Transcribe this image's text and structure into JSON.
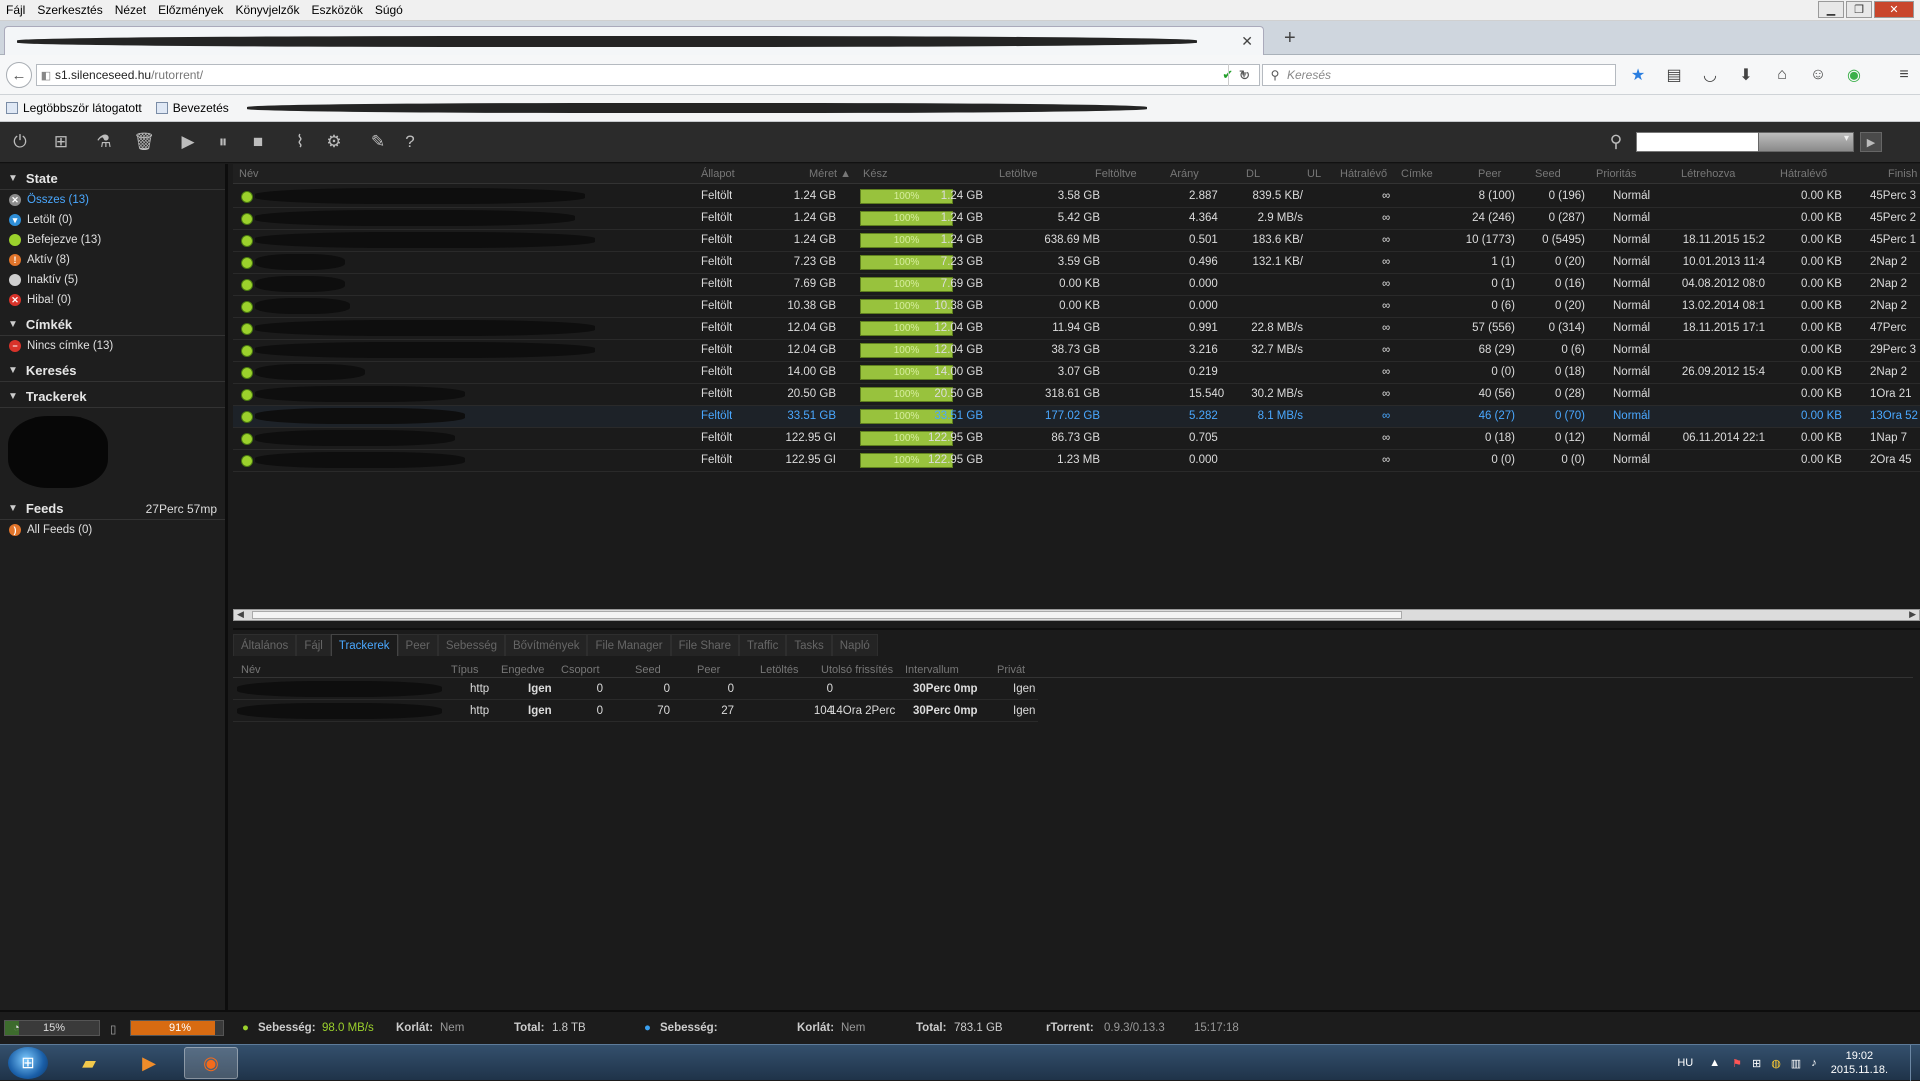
{
  "menu": [
    "Fájl",
    "Szerkesztés",
    "Nézet",
    "Előzmények",
    "Könyvjelzők",
    "Eszközök",
    "Súgó"
  ],
  "navbar": {
    "url_host": "s1.silenceseed.hu",
    "url_path": "/rutorrent/",
    "search_placeholder": "Keresés"
  },
  "bookmarks": [
    "Legtöbbször látogatott",
    "Bevezetés"
  ],
  "sidebar": {
    "state_title": "State",
    "state_items": [
      {
        "label": "Összes (13)",
        "color": "#8c8c8c",
        "glyph": "✕",
        "active": true
      },
      {
        "label": "Letölt (0)",
        "color": "#2f8fd8",
        "glyph": "▾",
        "active": false
      },
      {
        "label": "Befejezve (13)",
        "color": "#9bd12c",
        "glyph": "",
        "active": false
      },
      {
        "label": "Aktív (8)",
        "color": "#e0742a",
        "glyph": "!",
        "active": false
      },
      {
        "label": "Inaktív (5)",
        "color": "#cfcfcf",
        "glyph": "",
        "active": false
      },
      {
        "label": "Hiba! (0)",
        "color": "#d8332a",
        "glyph": "✕",
        "active": false
      }
    ],
    "labels_title": "Címkék",
    "labels_item": "Nincs címke (13)",
    "search_title": "Keresés",
    "trackers_title": "Trackerek",
    "feeds_title": "Feeds",
    "feeds_time": "27Perc 57mp",
    "feeds_item": "All Feeds (0)"
  },
  "table": {
    "headers": {
      "name": "Név",
      "status": "Állapot",
      "size": "Méret ▲",
      "done": "Kész",
      "downloaded": "Letöltve",
      "uploaded": "Feltöltve",
      "ratio": "Arány",
      "dl": "DL",
      "ul": "UL",
      "eta": "Hátralévő",
      "label": "Címke",
      "peers": "Peer",
      "seeds": "Seed",
      "priority": "Prioritás",
      "created": "Létrehozva",
      "remaining": "Hátralévő",
      "finished": "Finish"
    },
    "rows": [
      {
        "status": "Feltölt",
        "size": "1.24 GB",
        "done": "100%",
        "downloaded": "1.24 GB",
        "uploaded": "3.58 GB",
        "ratio": "2.887",
        "dl": "",
        "ul": "839.5 KB/",
        "eta": "∞",
        "peers": "8 (100)",
        "seeds": "0 (196)",
        "priority": "Normál",
        "created": "",
        "remaining": "0.00 KB",
        "finished": "45Perc 3",
        "sel": false
      },
      {
        "status": "Feltölt",
        "size": "1.24 GB",
        "done": "100%",
        "downloaded": "1.24 GB",
        "uploaded": "5.42 GB",
        "ratio": "4.364",
        "dl": "",
        "ul": "2.9 MB/s",
        "eta": "∞",
        "peers": "24 (246)",
        "seeds": "0 (287)",
        "priority": "Normál",
        "created": "",
        "remaining": "0.00 KB",
        "finished": "45Perc 2",
        "sel": false
      },
      {
        "status": "Feltölt",
        "size": "1.24 GB",
        "done": "100%",
        "downloaded": "1.24 GB",
        "uploaded": "638.69 MB",
        "ratio": "0.501",
        "dl": "",
        "ul": "183.6 KB/",
        "eta": "∞",
        "peers": "10 (1773)",
        "seeds": "0 (5495)",
        "priority": "Normál",
        "created": "18.11.2015 15:2",
        "remaining": "0.00 KB",
        "finished": "45Perc 1",
        "sel": false
      },
      {
        "status": "Feltölt",
        "size": "7.23 GB",
        "done": "100%",
        "downloaded": "7.23 GB",
        "uploaded": "3.59 GB",
        "ratio": "0.496",
        "dl": "",
        "ul": "132.1 KB/",
        "eta": "∞",
        "peers": "1 (1)",
        "seeds": "0 (20)",
        "priority": "Normál",
        "created": "10.01.2013 11:4",
        "remaining": "0.00 KB",
        "finished": "2Nap 2",
        "sel": false
      },
      {
        "status": "Feltölt",
        "size": "7.69 GB",
        "done": "100%",
        "downloaded": "7.69 GB",
        "uploaded": "0.00 KB",
        "ratio": "0.000",
        "dl": "",
        "ul": "",
        "eta": "∞",
        "peers": "0 (1)",
        "seeds": "0 (16)",
        "priority": "Normál",
        "created": "04.08.2012 08:0",
        "remaining": "0.00 KB",
        "finished": "2Nap 2",
        "sel": false
      },
      {
        "status": "Feltölt",
        "size": "10.38 GB",
        "done": "100%",
        "downloaded": "10.38 GB",
        "uploaded": "0.00 KB",
        "ratio": "0.000",
        "dl": "",
        "ul": "",
        "eta": "∞",
        "peers": "0 (6)",
        "seeds": "0 (20)",
        "priority": "Normál",
        "created": "13.02.2014 08:1",
        "remaining": "0.00 KB",
        "finished": "2Nap 2",
        "sel": false
      },
      {
        "status": "Feltölt",
        "size": "12.04 GB",
        "done": "100%",
        "downloaded": "12.04 GB",
        "uploaded": "11.94 GB",
        "ratio": "0.991",
        "dl": "",
        "ul": "22.8 MB/s",
        "eta": "∞",
        "peers": "57 (556)",
        "seeds": "0 (314)",
        "priority": "Normál",
        "created": "18.11.2015 17:1",
        "remaining": "0.00 KB",
        "finished": "47Perc",
        "sel": false
      },
      {
        "status": "Feltölt",
        "size": "12.04 GB",
        "done": "100%",
        "downloaded": "12.04 GB",
        "uploaded": "38.73 GB",
        "ratio": "3.216",
        "dl": "",
        "ul": "32.7 MB/s",
        "eta": "∞",
        "peers": "68 (29)",
        "seeds": "0 (6)",
        "priority": "Normál",
        "created": "",
        "remaining": "0.00 KB",
        "finished": "29Perc 3",
        "sel": false
      },
      {
        "status": "Feltölt",
        "size": "14.00 GB",
        "done": "100%",
        "downloaded": "14.00 GB",
        "uploaded": "3.07 GB",
        "ratio": "0.219",
        "dl": "",
        "ul": "",
        "eta": "∞",
        "peers": "0 (0)",
        "seeds": "0 (18)",
        "priority": "Normál",
        "created": "26.09.2012 15:4",
        "remaining": "0.00 KB",
        "finished": "2Nap 2",
        "sel": false
      },
      {
        "status": "Feltölt",
        "size": "20.50 GB",
        "done": "100%",
        "downloaded": "20.50 GB",
        "uploaded": "318.61 GB",
        "ratio": "15.540",
        "dl": "",
        "ul": "30.2 MB/s",
        "eta": "∞",
        "peers": "40 (56)",
        "seeds": "0 (28)",
        "priority": "Normál",
        "created": "",
        "remaining": "0.00 KB",
        "finished": "1Óra 21",
        "sel": false
      },
      {
        "status": "Feltölt",
        "size": "33.51 GB",
        "done": "100%",
        "downloaded": "33.51 GB",
        "uploaded": "177.02 GB",
        "ratio": "5.282",
        "dl": "",
        "ul": "8.1 MB/s",
        "eta": "∞",
        "peers": "46 (27)",
        "seeds": "0 (70)",
        "priority": "Normál",
        "created": "",
        "remaining": "0.00 KB",
        "finished": "13Óra 52",
        "sel": true
      },
      {
        "status": "Feltölt",
        "size": "122.95 GI",
        "done": "100%",
        "downloaded": "122.95 GB",
        "uploaded": "86.73 GB",
        "ratio": "0.705",
        "dl": "",
        "ul": "",
        "eta": "∞",
        "peers": "0 (18)",
        "seeds": "0 (12)",
        "priority": "Normál",
        "created": "06.11.2014 22:1",
        "remaining": "0.00 KB",
        "finished": "1Nap 7",
        "sel": false
      },
      {
        "status": "Feltölt",
        "size": "122.95 GI",
        "done": "100%",
        "downloaded": "122.95 GB",
        "uploaded": "1.23 MB",
        "ratio": "0.000",
        "dl": "",
        "ul": "",
        "eta": "∞",
        "peers": "0 (0)",
        "seeds": "0 (0)",
        "priority": "Normál",
        "created": "",
        "remaining": "0.00 KB",
        "finished": "2Óra 45",
        "sel": false
      }
    ]
  },
  "panel": {
    "tabs": [
      "Általános",
      "Fájl",
      "Trackerek",
      "Peer",
      "Sebesség",
      "Bővítmények",
      "File Manager",
      "File Share",
      "Traffic",
      "Tasks",
      "Napló"
    ],
    "active_tab": "Trackerek",
    "headers": {
      "name": "Név",
      "type": "Típus",
      "enabled": "Engedve",
      "group": "Csoport",
      "seed": "Seed",
      "peer": "Peer",
      "downloads": "Letöltés",
      "last": "Utolsó frissítés",
      "interval": "Intervallum",
      "private": "Privát"
    },
    "rows": [
      {
        "type": "http",
        "enabled": "Igen",
        "group": "0",
        "seed": "0",
        "peer": "0",
        "downloads": "0",
        "last": "",
        "interval": "30Perc 0mp",
        "private": "Igen"
      },
      {
        "type": "http",
        "enabled": "Igen",
        "group": "0",
        "seed": "70",
        "peer": "27",
        "downloads": "104",
        "last": "14Óra 2Perc",
        "interval": "30Perc 0mp",
        "private": "Igen"
      }
    ]
  },
  "status": {
    "cpu": "15%",
    "disk": "91%",
    "dl_speed_label": "Sebesség:",
    "dl_speed": "98.0 MB/s",
    "dl_limit_label": "Korlát:",
    "dl_limit": "Nem",
    "dl_total_label": "Total:",
    "dl_total": "1.8 TB",
    "ul_speed_label": "Sebesség:",
    "ul_limit_label": "Korlát:",
    "ul_limit": "Nem",
    "ul_total_label": "Total:",
    "ul_total": "783.1 GB",
    "rt_label": "rTorrent:",
    "rt_version": "0.9.3/0.13.3",
    "time": "15:17:18"
  },
  "taskbar": {
    "lang": "HU",
    "clock_time": "19:02",
    "clock_date": "2015.11.18."
  }
}
